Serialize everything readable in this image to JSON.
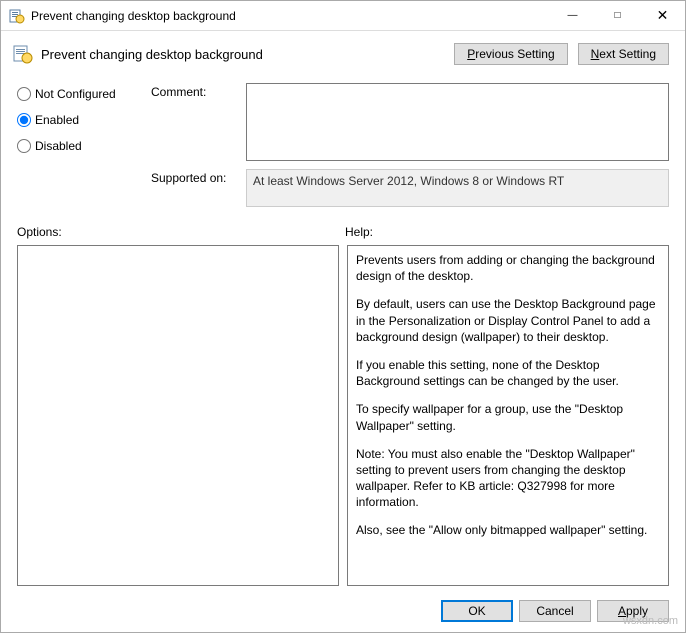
{
  "titlebar": {
    "title": "Prevent changing desktop background"
  },
  "header": {
    "title": "Prevent changing desktop background",
    "previous_btn": "Previous Setting",
    "next_btn": "Next Setting"
  },
  "state": {
    "not_configured_label": "Not Configured",
    "enabled_label": "Enabled",
    "disabled_label": "Disabled",
    "selected": "enabled"
  },
  "fields": {
    "comment_label": "Comment:",
    "comment_value": "",
    "supported_label": "Supported on:",
    "supported_value": "At least Windows Server 2012, Windows 8 or Windows RT"
  },
  "labels": {
    "options": "Options:",
    "help": "Help:"
  },
  "help": {
    "p1": "Prevents users from adding or changing the background design of the desktop.",
    "p2": "By default, users can use the Desktop Background page in the Personalization or Display Control Panel to add a background design (wallpaper) to their desktop.",
    "p3": "If you enable this setting, none of the Desktop Background settings can be changed by the user.",
    "p4": "To specify wallpaper for a group, use the \"Desktop Wallpaper\" setting.",
    "p5": "Note: You must also enable the \"Desktop Wallpaper\" setting to prevent users from changing the desktop wallpaper. Refer to KB article: Q327998 for more information.",
    "p6": "Also, see the \"Allow only bitmapped wallpaper\" setting."
  },
  "footer": {
    "ok": "OK",
    "cancel": "Cancel",
    "apply": "Apply"
  },
  "watermark": "wsxdn.com"
}
